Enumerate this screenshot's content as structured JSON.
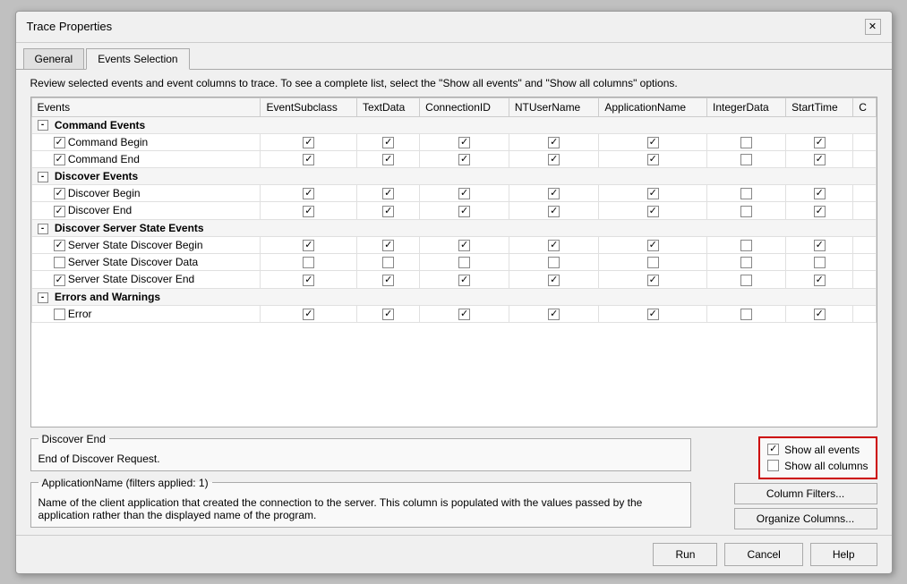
{
  "dialog": {
    "title": "Trace Properties",
    "close_label": "✕"
  },
  "tabs": [
    {
      "label": "General",
      "active": false
    },
    {
      "label": "Events Selection",
      "active": true
    }
  ],
  "hint": "Review selected events and event columns to trace. To see a complete list, select the \"Show all events\" and \"Show all columns\" options.",
  "table": {
    "columns": [
      "Events",
      "EventSubclass",
      "TextData",
      "ConnectionID",
      "NTUserName",
      "ApplicationName",
      "IntegerData",
      "StartTime",
      "C"
    ],
    "groups": [
      {
        "name": "Command Events",
        "rows": [
          {
            "name": "Command Begin",
            "cells": [
              true,
              true,
              true,
              true,
              true,
              false,
              true
            ]
          },
          {
            "name": "Command End",
            "cells": [
              true,
              true,
              true,
              true,
              true,
              false,
              true
            ]
          }
        ]
      },
      {
        "name": "Discover Events",
        "rows": [
          {
            "name": "Discover Begin",
            "cells": [
              true,
              true,
              true,
              true,
              true,
              false,
              true
            ]
          },
          {
            "name": "Discover End",
            "cells": [
              true,
              true,
              true,
              true,
              true,
              false,
              true
            ]
          }
        ]
      },
      {
        "name": "Discover Server State Events",
        "rows": [
          {
            "name": "Server State Discover Begin",
            "cells": [
              true,
              true,
              true,
              true,
              true,
              false,
              true
            ]
          },
          {
            "name": "Server State Discover Data",
            "cells": [
              false,
              false,
              false,
              false,
              false,
              false,
              false
            ]
          },
          {
            "name": "Server State Discover End",
            "cells": [
              true,
              true,
              true,
              true,
              true,
              false,
              true
            ]
          }
        ]
      },
      {
        "name": "Errors and Warnings",
        "rows": [
          {
            "name": "Error",
            "cells": [
              true,
              true,
              true,
              true,
              true,
              false,
              true
            ]
          }
        ]
      }
    ]
  },
  "discover_end_box": {
    "title": "Discover End",
    "content": "End of Discover Request."
  },
  "app_name_box": {
    "title": "ApplicationName (filters applied: 1)",
    "content": "Name of the client application that created the connection to the server. This column is populated with the values passed by the application rather than the displayed name of the program."
  },
  "show_options": {
    "show_all_events_label": "Show all events",
    "show_all_columns_label": "Show all columns",
    "show_all_events_checked": true,
    "show_all_columns_checked": false
  },
  "action_buttons": {
    "column_filters": "Column Filters...",
    "organize_columns": "Organize Columns..."
  },
  "footer_buttons": {
    "run": "Run",
    "cancel": "Cancel",
    "help": "Help"
  }
}
